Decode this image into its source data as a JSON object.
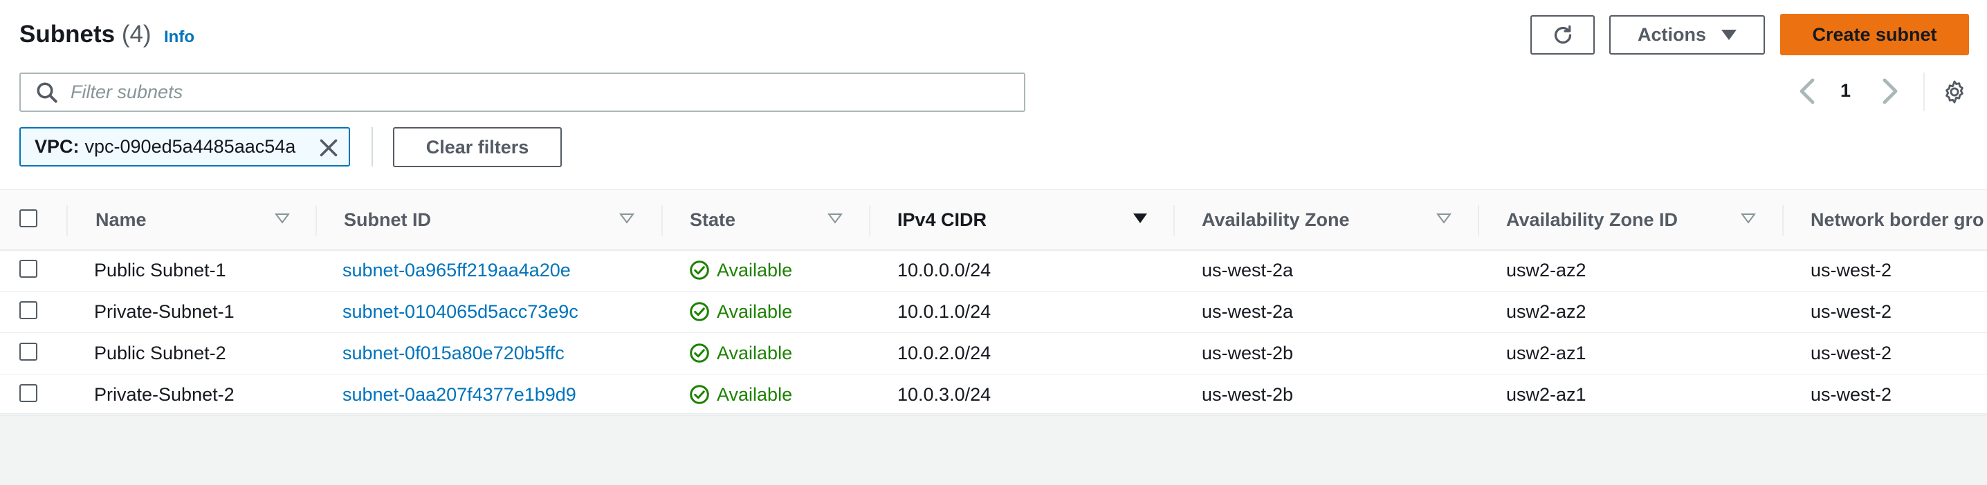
{
  "header": {
    "title": "Subnets",
    "count": "(4)",
    "info_label": "Info",
    "actions_label": "Actions",
    "create_label": "Create subnet",
    "refresh_icon": "refresh-icon"
  },
  "search": {
    "placeholder": "Filter subnets",
    "value": ""
  },
  "pagination": {
    "current_page": "1"
  },
  "filter_token": {
    "key": "VPC:",
    "value": "vpc-090ed5a4485aac54a"
  },
  "clear_filters_label": "Clear filters",
  "table": {
    "columns": [
      "Name",
      "Subnet ID",
      "State",
      "IPv4 CIDR",
      "Availability Zone",
      "Availability Zone ID",
      "Network border gro"
    ],
    "rows": [
      {
        "name": "Public Subnet-1",
        "subnet_id": "subnet-0a965ff219aa4a20e",
        "state": "Available",
        "cidr": "10.0.0.0/24",
        "az": "us-west-2a",
        "az_id": "usw2-az2",
        "nbg": "us-west-2"
      },
      {
        "name": "Private-Subnet-1",
        "subnet_id": "subnet-0104065d5acc73e9c",
        "state": "Available",
        "cidr": "10.0.1.0/24",
        "az": "us-west-2a",
        "az_id": "usw2-az2",
        "nbg": "us-west-2"
      },
      {
        "name": "Public Subnet-2",
        "subnet_id": "subnet-0f015a80e720b5ffc",
        "state": "Available",
        "cidr": "10.0.2.0/24",
        "az": "us-west-2b",
        "az_id": "usw2-az1",
        "nbg": "us-west-2"
      },
      {
        "name": "Private-Subnet-2",
        "subnet_id": "subnet-0aa207f4377e1b9d9",
        "state": "Available",
        "cidr": "10.0.3.0/24",
        "az": "us-west-2b",
        "az_id": "usw2-az1",
        "nbg": "us-west-2"
      }
    ]
  },
  "colors": {
    "primary": "#ec7211",
    "link": "#0073bb",
    "available": "#1d8102"
  }
}
